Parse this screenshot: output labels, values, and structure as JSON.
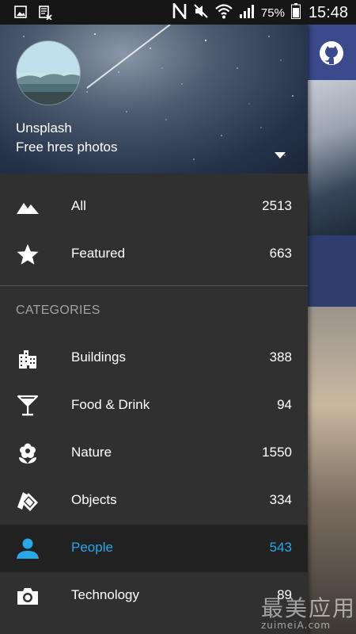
{
  "status_bar": {
    "battery_percent": "75%",
    "clock": "15:48"
  },
  "drawer": {
    "account_name": "Unsplash",
    "account_subtitle": "Free hres photos",
    "main_items": [
      {
        "label": "All",
        "count": "2513",
        "icon": "mountains-icon"
      },
      {
        "label": "Featured",
        "count": "663",
        "icon": "star-icon"
      }
    ],
    "categories_header": "CATEGORIES",
    "categories": [
      {
        "label": "Buildings",
        "count": "388",
        "icon": "buildings-icon",
        "active": false
      },
      {
        "label": "Food & Drink",
        "count": "94",
        "icon": "cocktail-icon",
        "active": false
      },
      {
        "label": "Nature",
        "count": "1550",
        "icon": "flower-icon",
        "active": false
      },
      {
        "label": "Objects",
        "count": "334",
        "icon": "objects-icon",
        "active": false
      },
      {
        "label": "People",
        "count": "543",
        "icon": "person-icon",
        "active": true
      },
      {
        "label": "Technology",
        "count": "89",
        "icon": "camera-icon",
        "active": false
      }
    ],
    "active_color": "#29a8e8"
  },
  "watermark": {
    "main": "最美应用",
    "sub": "zuimeiA.com"
  }
}
